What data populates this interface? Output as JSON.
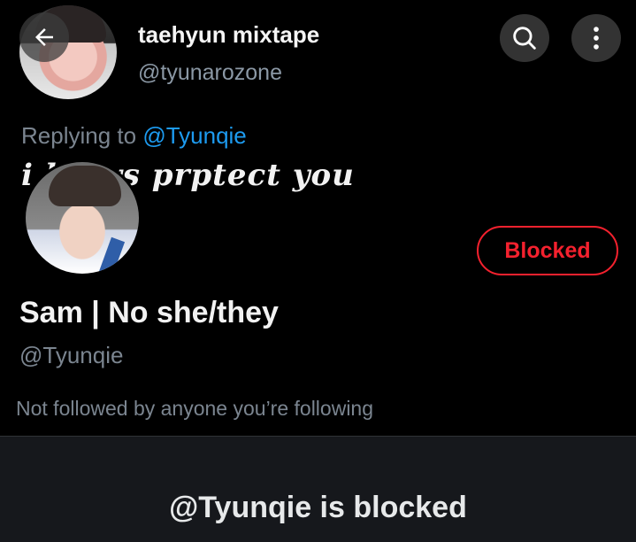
{
  "tweet": {
    "name": "taehyun mixtape",
    "handle": "@tyunarozone",
    "replying_prefix": "Replying to ",
    "replying_mention": "@Tyunqie",
    "text": "i   lways prptect you"
  },
  "profile": {
    "display_name": "Sam | No she/they",
    "handle": "@Tyunqie",
    "followed_status": "Not followed by anyone you’re following",
    "blocked_button": "Blocked"
  },
  "blocked_notice": {
    "title": "@Tyunqie is blocked"
  },
  "colors": {
    "background": "#000000",
    "accent_blue": "#1d9bf0",
    "blocked_red": "#f4212e",
    "muted_text": "#7b8590",
    "panel": "#16181c"
  },
  "icons": [
    "arrow-left-icon",
    "search-icon",
    "more-vertical-icon"
  ]
}
